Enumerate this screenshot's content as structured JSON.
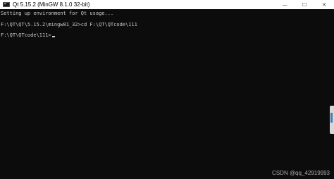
{
  "window": {
    "title": "Qt 5.15.2 (MinGW 8.1.0 32-bit)",
    "controls": {
      "minimize": "—",
      "maximize": "☐",
      "close": "✕"
    }
  },
  "console": {
    "lines": [
      "Setting up environment for Qt usage...",
      "F:\\QT\\QT\\5.15.2\\mingw81_32>cd F:\\QT\\QTcode\\111",
      "F:\\QT\\QTcode\\111>"
    ]
  },
  "watermark": "CSDN @qq_42919993",
  "colors": {
    "background": "#0c0c0c",
    "text": "#cccccc",
    "titlebar": "#ffffff"
  },
  "icons": {
    "app": "console-icon"
  }
}
